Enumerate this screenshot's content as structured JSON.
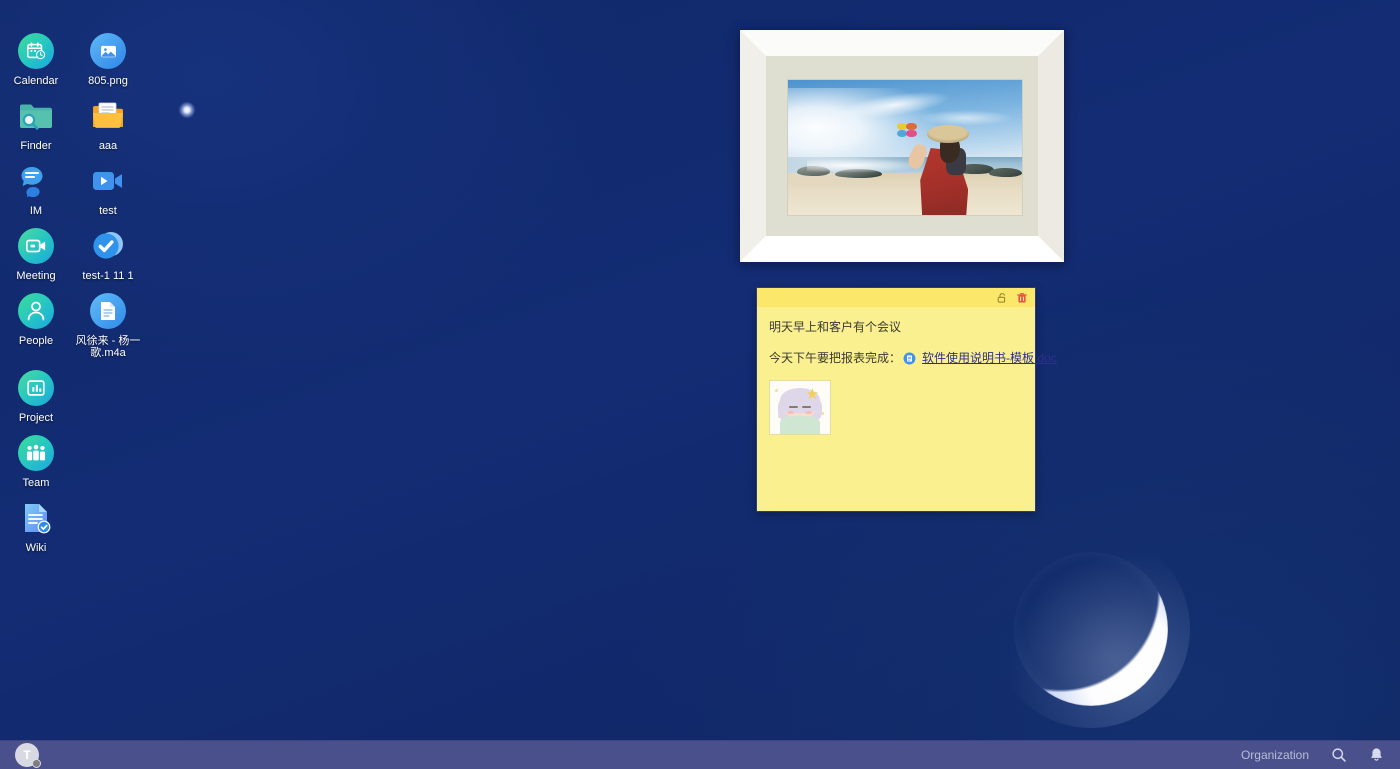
{
  "desktop": {
    "background_color": "#112a6e",
    "icons": [
      {
        "label": "Calendar",
        "icon": "calendar-icon",
        "type": "app"
      },
      {
        "label": "805.png",
        "icon": "image-file-icon",
        "type": "file"
      },
      {
        "label": "Finder",
        "icon": "finder-icon",
        "type": "app"
      },
      {
        "label": "aaa",
        "icon": "folder-open-icon",
        "type": "folder"
      },
      {
        "label": "IM",
        "icon": "chat-bubbles-icon",
        "type": "app"
      },
      {
        "label": "test",
        "icon": "video-camera-icon",
        "type": "file"
      },
      {
        "label": "Meeting",
        "icon": "meeting-video-icon",
        "type": "app"
      },
      {
        "label": "test-1 11 1",
        "icon": "check-circle-icon",
        "type": "file"
      },
      {
        "label": "People",
        "icon": "person-icon",
        "type": "app"
      },
      {
        "label": "风徐来 - 杨一歌.m4a",
        "icon": "document-icon",
        "type": "file"
      },
      {
        "label": "Project",
        "icon": "chart-board-icon",
        "type": "app"
      },
      {
        "label": "Team",
        "icon": "team-group-icon",
        "type": "app"
      },
      {
        "label": "Wiki",
        "icon": "document-check-icon",
        "type": "app"
      }
    ]
  },
  "photo_widget": {
    "name": "photo-frame-widget",
    "alt": "woman on beach holding pinwheel at sunrise",
    "frame_color": "#ffffff",
    "mat_color": "#dedfd0"
  },
  "sticky_note": {
    "background_color": "#fbf08f",
    "toolbar": {
      "lock_icon": "unlock-icon",
      "delete_icon": "trash-icon"
    },
    "lines": [
      "明天早上和客户有个会议",
      "今天下午要把报表完成："
    ],
    "attachment": {
      "icon": "doc-attachment-icon",
      "label": "软件使用说明书-模板.doc"
    },
    "thumbnail_alt": "anime girl illustration"
  },
  "moon": {
    "name": "crescent-moon",
    "phase": "waxing-crescent"
  },
  "taskbar": {
    "background_color": "#4a508c",
    "avatar": {
      "initial": "T",
      "status": "offline"
    },
    "organization_label": "Organization",
    "search_icon": "search-icon",
    "notification_icon": "bell-icon"
  }
}
